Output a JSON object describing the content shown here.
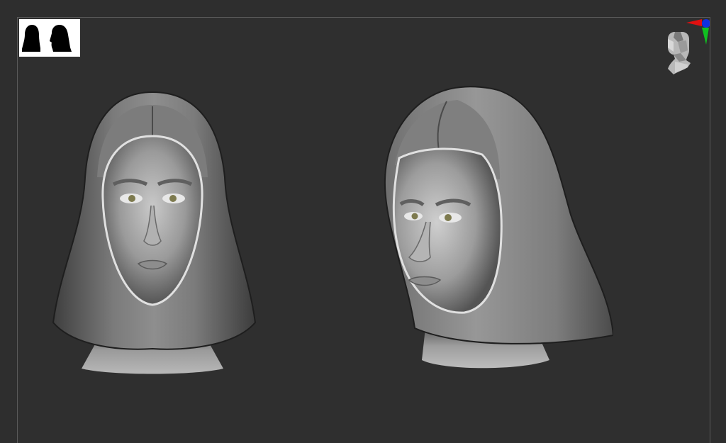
{
  "app": {
    "background_color": "#2e2e2e",
    "frame_color": "#5a5a5a"
  },
  "viewport": {
    "thumbnail": {
      "icon": "head-silhouette-icon",
      "count": 2
    },
    "navigation_gizmo": {
      "icon": "head-orientation-icon",
      "axis_colors": {
        "x": "#e01010",
        "y": "#10c020",
        "z": "#1030e0"
      }
    },
    "models": [
      {
        "name": "front-view",
        "icon": "sculpt-head-front"
      },
      {
        "name": "three-quarter-view",
        "icon": "sculpt-head-three-quarter"
      }
    ]
  }
}
